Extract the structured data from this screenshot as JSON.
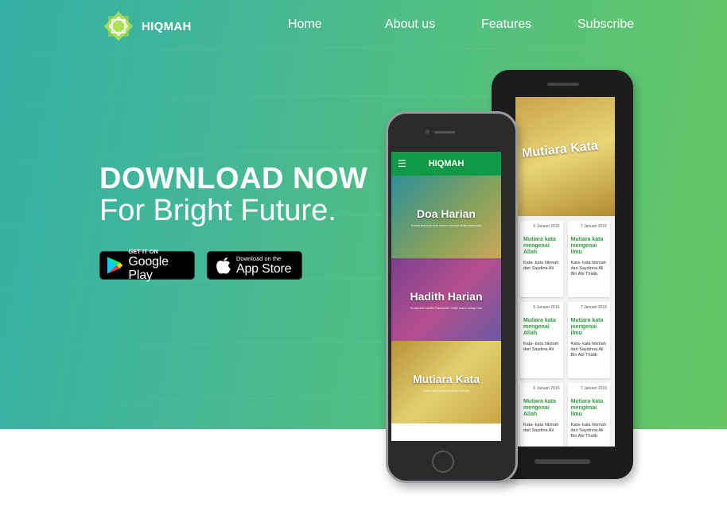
{
  "brand": {
    "name": "HIQMAH"
  },
  "nav": {
    "items": [
      {
        "label": "Home"
      },
      {
        "label": "About us"
      },
      {
        "label": "Features"
      },
      {
        "label": "Subscribe"
      }
    ]
  },
  "hero": {
    "headline": "DOWNLOAD NOW",
    "subline": "For Bright Future."
  },
  "stores": {
    "google": {
      "small": "GET IT ON",
      "big": "Google Play"
    },
    "apple": {
      "small": "Download on the",
      "big": "App Store"
    }
  },
  "phone_front": {
    "app_title": "HIQMAH",
    "cards": [
      {
        "title": "Doa Harian",
        "subtitle": "Kumpulan doa-doa harian beserta terjemahannya"
      },
      {
        "title": "Hadith Harian",
        "subtitle": "Kumpulan hadith Rasulullah SAW untuk setiap hari"
      },
      {
        "title": "Mutiara Kata",
        "subtitle": "Kata-kata mutiara penuh hikmah"
      }
    ]
  },
  "phone_back": {
    "hero_title": "Mutiara Kata",
    "grid": [
      {
        "date": "6 Januari 2016",
        "title": "Mutiara kata mengenai Allah",
        "text": "Kata- kata hikmah dari Saydina Ali"
      },
      {
        "date": "7 Januari 2016",
        "title": "Mutiara kata mengenai ilmu",
        "text": "Kata- kata hikmah dari Saydinna Ali Bin Abi Thalib"
      },
      {
        "date": "6 Januari 2016",
        "title": "Mutiara kata mengenai Allah",
        "text": "Kata- kata hikmah dari Saydina Ali"
      },
      {
        "date": "7 Januari 2016",
        "title": "Mutiara kata mengenai ilmu",
        "text": "Kata- kata hikmah dari Saydinna Ali Bin Abi Thalib"
      },
      {
        "date": "6 Januari 2016",
        "title": "Mutiara kata mengenai Allah",
        "text": "Kata- kata hikmah dari Saydina Ali"
      },
      {
        "date": "7 Januari 2016",
        "title": "Mutiara kata mengenai ilmu",
        "text": "Kata- kata hikmah dari Saydinna Ali Bin Abi Thalib"
      }
    ]
  },
  "colors": {
    "gradient_start": "#33b0a6",
    "gradient_end": "#66c764",
    "app_bar": "#109a46",
    "accent_green": "#2f9b3f"
  }
}
